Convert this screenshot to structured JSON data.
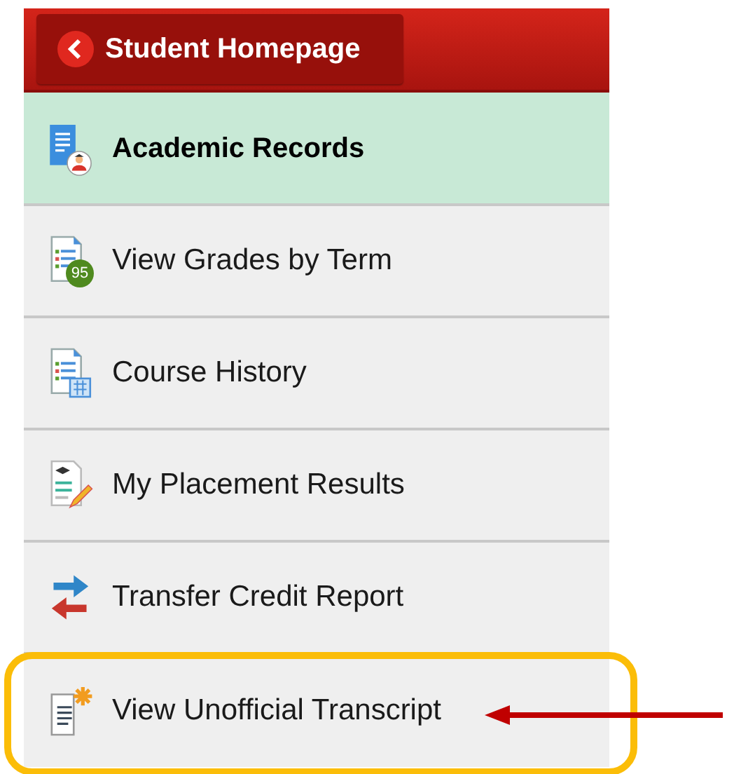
{
  "back_button": {
    "label": "Student Homepage"
  },
  "section_heading": {
    "label": "Academic Records"
  },
  "menu_items": [
    {
      "label": "View Grades by Term",
      "kind": "grades",
      "badge": "95",
      "highlighted": false
    },
    {
      "label": "Course History",
      "kind": "history",
      "highlighted": false
    },
    {
      "label": "My Placement Results",
      "kind": "placement",
      "highlighted": false
    },
    {
      "label": "Transfer Credit Report",
      "kind": "transfer",
      "highlighted": false
    },
    {
      "label": "View Unofficial Transcript",
      "kind": "transcript",
      "highlighted": true
    }
  ]
}
